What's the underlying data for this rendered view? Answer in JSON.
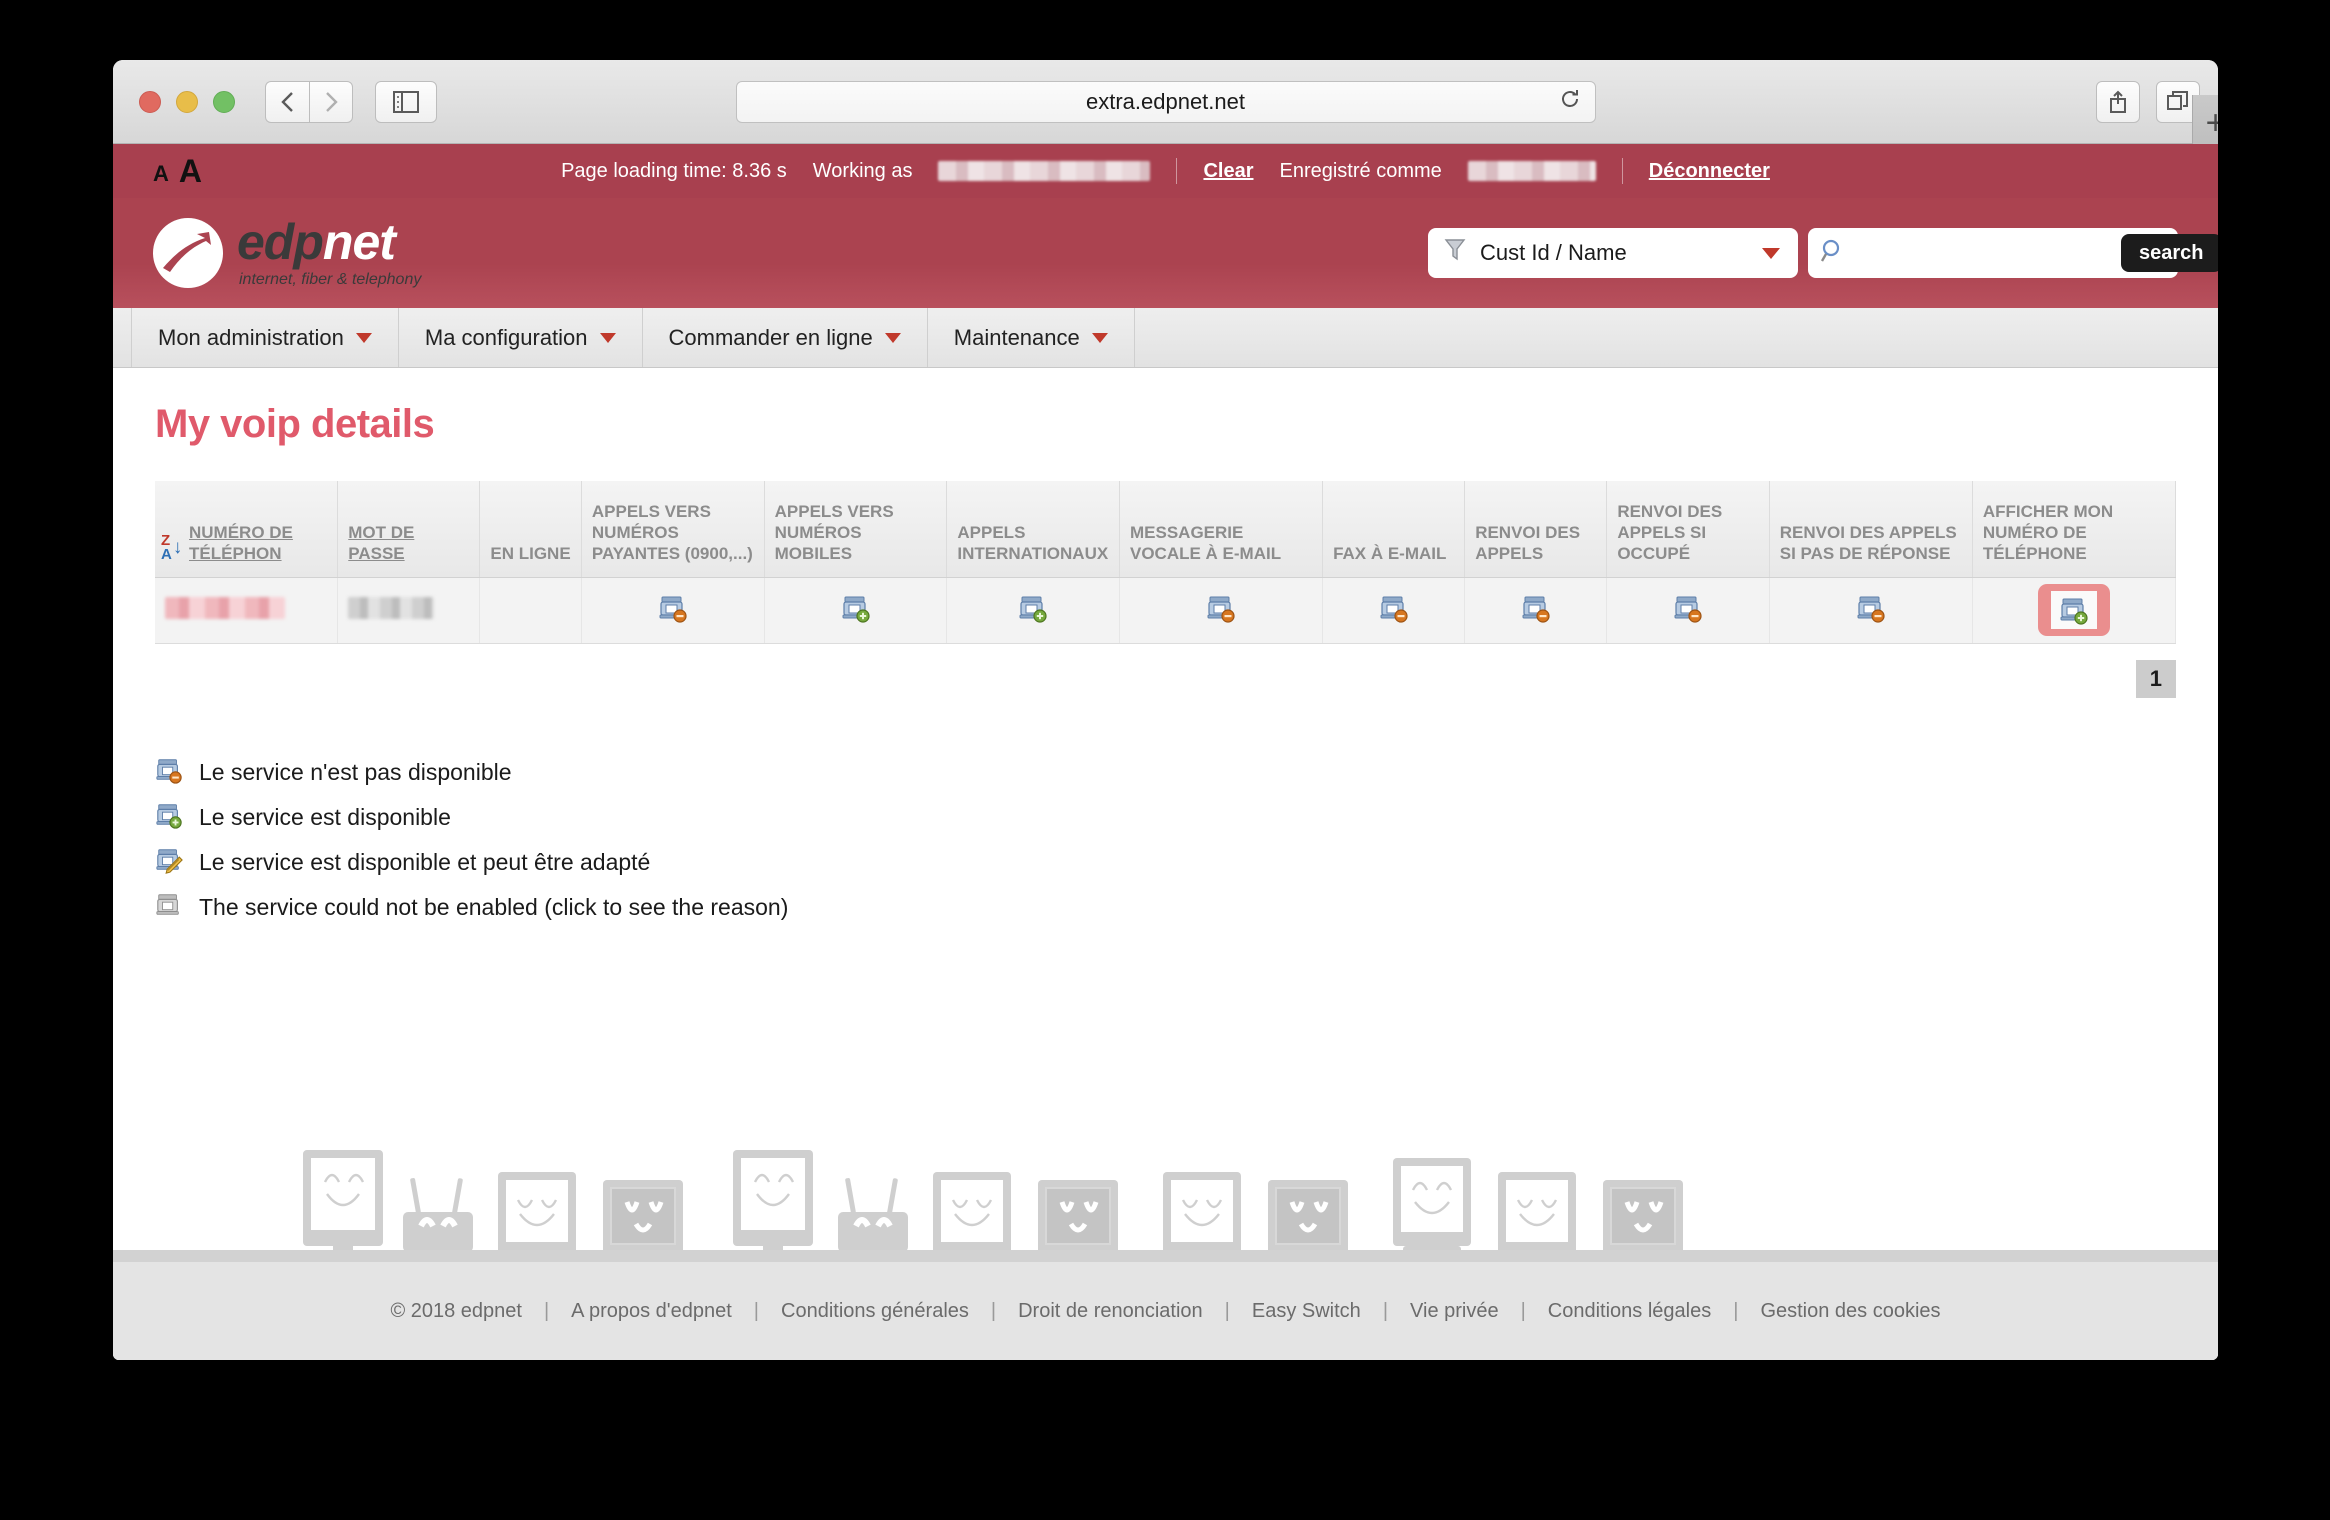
{
  "browser": {
    "url": "extra.edpnet.net",
    "back_icon": "chevron-left-icon",
    "forward_icon": "chevron-right-icon",
    "sidebar_icon": "sidebar-icon",
    "reload_icon": "reload-icon",
    "share_icon": "share-icon",
    "tabs_icon": "tabs-icon",
    "newtab_label": "+"
  },
  "topbar": {
    "font_small": "A",
    "font_large": "A",
    "loading_time": "Page loading time: 8.36 s",
    "working_as_label": "Working as",
    "working_as_value": "",
    "clear_label": "Clear",
    "registered_label": "Enregistré comme",
    "registered_value": "",
    "logout_label": "Déconnecter"
  },
  "header": {
    "logo_edp": "edp",
    "logo_net": "net",
    "tagline": "internet, fiber & telephony",
    "filter": {
      "icon": "funnel-icon",
      "value": "Cust Id / Name",
      "caret": "chevron-down-icon"
    },
    "search": {
      "icon": "search-icon",
      "value": "",
      "placeholder": "",
      "button_label": "search"
    }
  },
  "nav": {
    "items": [
      {
        "label": "Mon administration"
      },
      {
        "label": "Ma configuration"
      },
      {
        "label": "Commander en ligne"
      },
      {
        "label": "Maintenance"
      }
    ]
  },
  "main": {
    "title": "My voip details",
    "table": {
      "sort_indicator": "sort-descending-za-icon",
      "columns": [
        "NUMÉRO DE TÉLÉPHON",
        "MOT DE PASSE",
        "EN LIGNE",
        "APPELS VERS NUMÉROS PAYANTES (0900,...)",
        "APPELS VERS NUMÉROS MOBILES",
        "APPELS INTERNATIONAUX",
        "MESSAGERIE VOCALE À E-MAIL",
        "FAX À E-MAIL",
        "RENVOI DES APPELS",
        "RENVOI DES APPELS SI OCCUPÉ",
        "RENVOI DES APPELS SI PAS DE RÉPONSE",
        "AFFICHER MON NUMÉRO DE TÉLÉPHONE"
      ],
      "rows": [
        {
          "phone_number": "",
          "password": "",
          "online": "",
          "cells": [
            {
              "icon": "phone-unavailable-icon",
              "state": "unavailable"
            },
            {
              "icon": "phone-available-icon",
              "state": "available"
            },
            {
              "icon": "phone-available-icon",
              "state": "available"
            },
            {
              "icon": "phone-unavailable-icon",
              "state": "unavailable"
            },
            {
              "icon": "phone-unavailable-icon",
              "state": "unavailable"
            },
            {
              "icon": "phone-unavailable-icon",
              "state": "unavailable"
            },
            {
              "icon": "phone-unavailable-icon",
              "state": "unavailable"
            },
            {
              "icon": "phone-unavailable-icon",
              "state": "unavailable"
            },
            {
              "icon": "phone-available-icon",
              "state": "available",
              "highlighted": true
            }
          ]
        }
      ]
    },
    "pagination": {
      "current": "1"
    },
    "legend": [
      {
        "icon": "phone-unavailable-icon",
        "text": "Le service n'est pas disponible"
      },
      {
        "icon": "phone-available-icon",
        "text": "Le service est disponible"
      },
      {
        "icon": "phone-editable-icon",
        "text": "Le service est disponible et peut être adapté"
      },
      {
        "icon": "phone-disabled-icon",
        "text": "The service could not be enabled (click to see the reason)"
      }
    ]
  },
  "footer": {
    "copyright": "© 2018 edpnet",
    "links": [
      "A propos d'edpnet",
      "Conditions générales",
      "Droit de renonciation",
      "Easy Switch",
      "Vie privée",
      "Conditions légales",
      "Gestion des cookies"
    ],
    "separator": "|"
  },
  "colors": {
    "brand_red": "#ab4350",
    "topbar_red": "#a8404f",
    "title_pink": "#e05a6b",
    "accent_caret": "#c0392b",
    "highlight": "#ea8e8e"
  }
}
